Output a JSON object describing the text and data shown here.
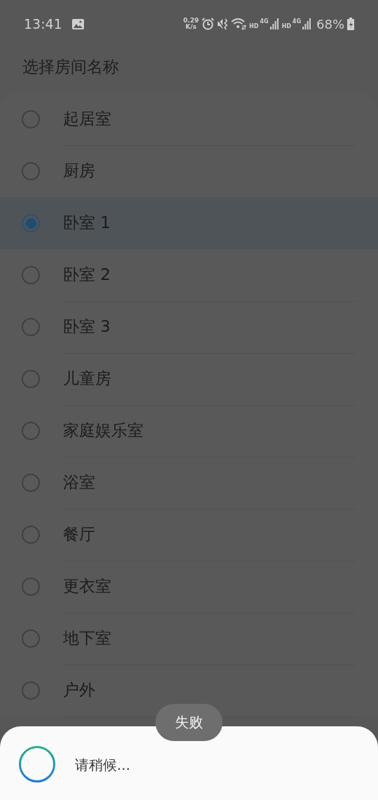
{
  "status_bar": {
    "time": "13:41",
    "net_speed": [
      "0.29",
      "K/s"
    ],
    "sims": [
      {
        "hd": "HD",
        "network": "4G"
      },
      {
        "hd": "HD",
        "network": "4G"
      }
    ],
    "battery": "68%"
  },
  "title": "选择房间名称",
  "rooms": [
    {
      "label": "起居室",
      "selected": false
    },
    {
      "label": "厨房",
      "selected": false
    },
    {
      "label": "卧室 1",
      "selected": true
    },
    {
      "label": "卧室 2",
      "selected": false
    },
    {
      "label": "卧室 3",
      "selected": false
    },
    {
      "label": "儿童房",
      "selected": false
    },
    {
      "label": "家庭娱乐室",
      "selected": false
    },
    {
      "label": "浴室",
      "selected": false
    },
    {
      "label": "餐厅",
      "selected": false
    },
    {
      "label": "更衣室",
      "selected": false
    },
    {
      "label": "地下室",
      "selected": false
    },
    {
      "label": "户外",
      "selected": false
    }
  ],
  "toast": "失败",
  "progress_dialog": {
    "message": "请稍候..."
  }
}
